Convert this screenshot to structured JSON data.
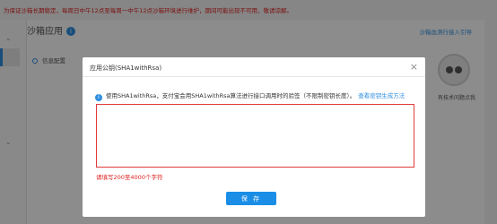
{
  "background": {
    "notice": "为保证沙箱长期稳定，每周日中午12点至每周一中午12点沙箱环境进行维护，期间可能出现不可用，敬请谅解。",
    "title": "沙箱应用",
    "help_link": "沙箱血测行接入引导",
    "section": "信息配置",
    "robot_label": "有技术问题点我"
  },
  "modal": {
    "title": "应用公钥(SHA1withRsa)",
    "tip": "使用SHA1withRsa，支付宝会用SHA1withRsa算法进行接口调用时的验签（不限制密钥长度）。",
    "tip_link": "查看密钥生成方法",
    "textarea_value": "",
    "error": "请填写200至4000个字符",
    "save_label": "保 存",
    "close_glyph": "×"
  }
}
